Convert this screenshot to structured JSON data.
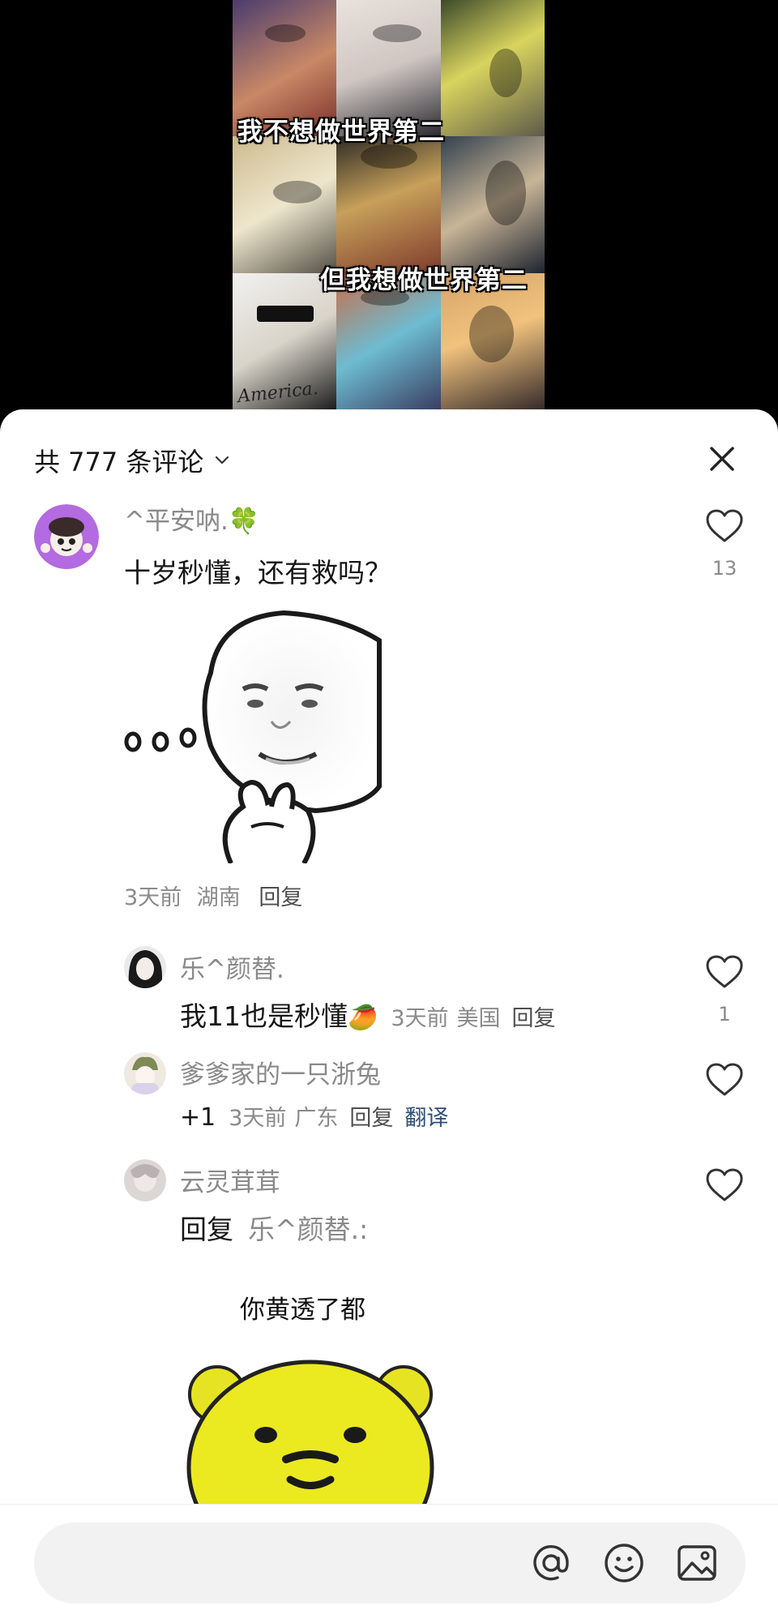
{
  "video": {
    "caption_top": "我不想做世界第二",
    "caption_bottom": "但我想做世界第二",
    "artwork_text": "America."
  },
  "header": {
    "comment_count_label": "共 777 条评论",
    "dropdown_icon": "chevron-down-icon",
    "close_icon": "close-icon"
  },
  "comments": [
    {
      "username": "^平安呐.",
      "username_emoji": "🍀",
      "text": "十岁秒懂，还有救吗？",
      "sticker": "thinking-face-meme",
      "time": "3天前",
      "location": "湖南",
      "reply_label": "回复",
      "likes": "13",
      "replies": [
        {
          "username": "乐^颜替.",
          "text": "我11也是秒懂",
          "emoji": "🥭",
          "time": "3天前",
          "location": "美国",
          "reply_label": "回复",
          "likes": "1"
        },
        {
          "username": "爹爹家的一只浙兔",
          "text": "+1",
          "time": "3天前",
          "location": "广东",
          "reply_label": "回复",
          "translate_label": "翻译",
          "likes": ""
        },
        {
          "username": "云灵茸茸",
          "reply_prefix": "回复",
          "reply_target": "乐^颜替.:",
          "image_caption": "你黄透了都",
          "sticker": "yellow-bear-meme",
          "likes": ""
        }
      ]
    }
  ],
  "input_bar": {
    "placeholder": "",
    "icons": [
      "at-icon",
      "emoji-icon",
      "image-icon"
    ]
  },
  "colors": {
    "text_primary": "#161616",
    "text_secondary": "#8a8a8a",
    "link_blue": "#2f4f78",
    "input_bg": "#f2f2f2"
  }
}
